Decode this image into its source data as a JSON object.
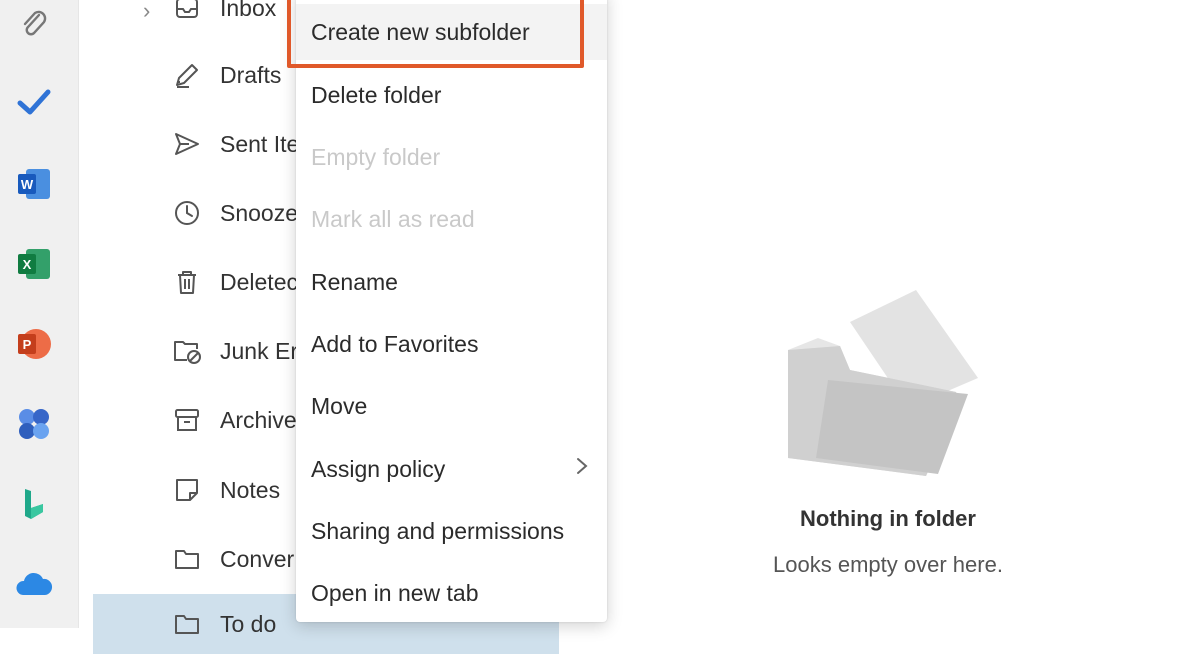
{
  "rail": {
    "icons": [
      "attach-icon",
      "todo-check-icon",
      "word-icon",
      "excel-icon",
      "powerpoint-icon",
      "teams-icon",
      "bookings-icon",
      "onedrive-icon"
    ]
  },
  "folders": {
    "items": [
      {
        "label": "Inbox",
        "icon": "inbox-icon"
      },
      {
        "label": "Drafts",
        "icon": "drafts-icon"
      },
      {
        "label": "Sent Ite",
        "icon": "sent-icon"
      },
      {
        "label": "Snooze",
        "icon": "clock-icon"
      },
      {
        "label": "Deletec",
        "icon": "trash-icon"
      },
      {
        "label": "Junk Er",
        "icon": "junk-folder-icon"
      },
      {
        "label": "Archive",
        "icon": "archive-icon"
      },
      {
        "label": "Notes",
        "icon": "note-icon"
      },
      {
        "label": "Conver",
        "icon": "folder-icon"
      },
      {
        "label": "To do",
        "icon": "folder-icon"
      }
    ]
  },
  "context_menu": {
    "items": [
      {
        "label": "Create new subfolder",
        "state": "highlighted"
      },
      {
        "label": "Delete folder",
        "state": "enabled"
      },
      {
        "label": "Empty folder",
        "state": "disabled"
      },
      {
        "label": "Mark all as read",
        "state": "disabled"
      },
      {
        "label": "Rename",
        "state": "enabled"
      },
      {
        "label": "Add to Favorites",
        "state": "enabled"
      },
      {
        "label": "Move",
        "state": "enabled"
      },
      {
        "label": "Assign policy",
        "state": "enabled",
        "submenu": "chevron-right-icon"
      },
      {
        "label": "Sharing and permissions",
        "state": "enabled"
      },
      {
        "label": "Open in new tab",
        "state": "enabled"
      }
    ],
    "highlight_color": "#e0592a"
  },
  "empty_state": {
    "title": "Nothing in folder",
    "subtitle": "Looks empty over here."
  }
}
